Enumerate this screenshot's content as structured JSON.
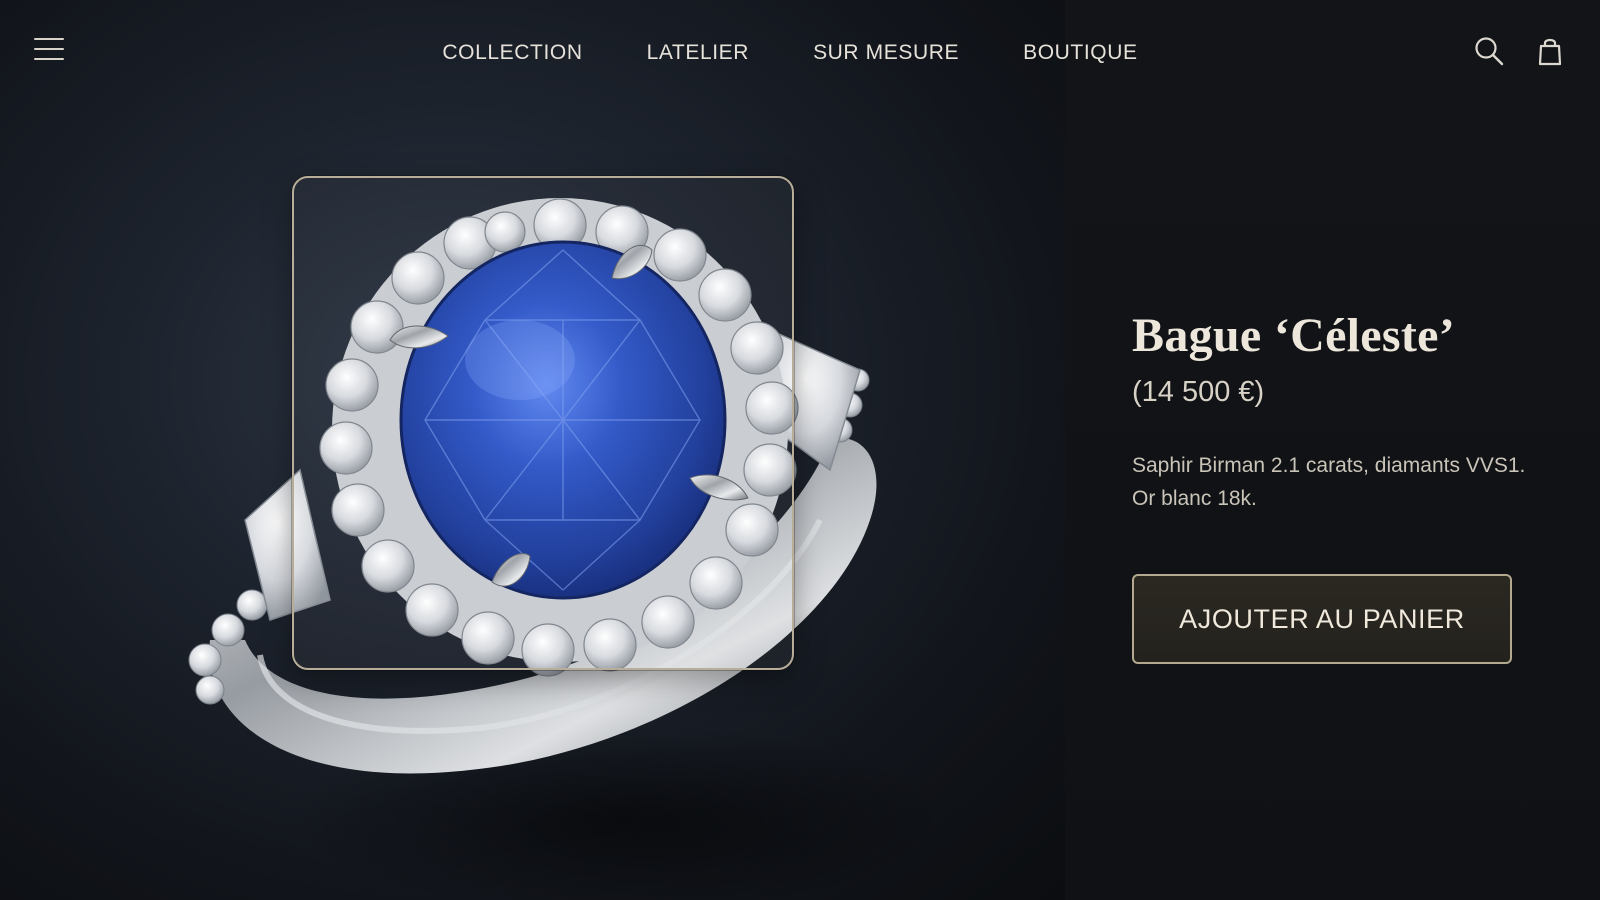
{
  "nav": {
    "items": [
      {
        "label": "COLLECTION"
      },
      {
        "label": "LATELIER"
      },
      {
        "label": "SUR MESURE"
      },
      {
        "label": "BOUTIQUE"
      }
    ]
  },
  "icons": {
    "menu": "hamburger-menu-icon",
    "search": "search-icon",
    "bag": "shopping-bag-icon"
  },
  "product": {
    "title": "Bague ‘Céleste’",
    "price": "(14 500 €)",
    "description_line1": "Saphir Birman 2.1 carats, diamants VVS1.",
    "description_line2": "Or blanc 18k.",
    "cta_label": "AJOUTER AU PANIER"
  },
  "colors": {
    "background": "#0e1014",
    "accent_border": "#b3a98f",
    "sapphire": "#2a4fb8",
    "text": "#ece6db"
  }
}
